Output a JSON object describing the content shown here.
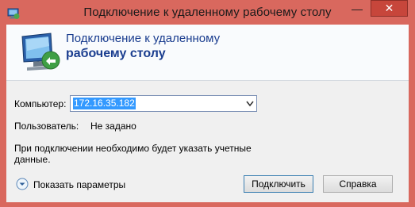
{
  "window": {
    "title": "Подключение к удаленному рабочему столу",
    "minimize_glyph": "—",
    "close_glyph": "✕",
    "accent": "#d9685e"
  },
  "header": {
    "line1": "Подключение к удаленному",
    "line2": "рабочему столу"
  },
  "form": {
    "computer_label": "Компьютер:",
    "computer_value": "172.16.35.182",
    "user_label": "Пользователь:",
    "user_value": "Не задано",
    "info": "При подключении необходимо будет указать учетные данные."
  },
  "footer": {
    "show_options": "Показать параметры",
    "connect": "Подключить",
    "help": "Справка"
  },
  "icons": {
    "app": "remote-desktop-icon",
    "header": "monitor-connection-icon",
    "expand": "expand-down-icon",
    "dropdown": "chevron-down-icon"
  }
}
